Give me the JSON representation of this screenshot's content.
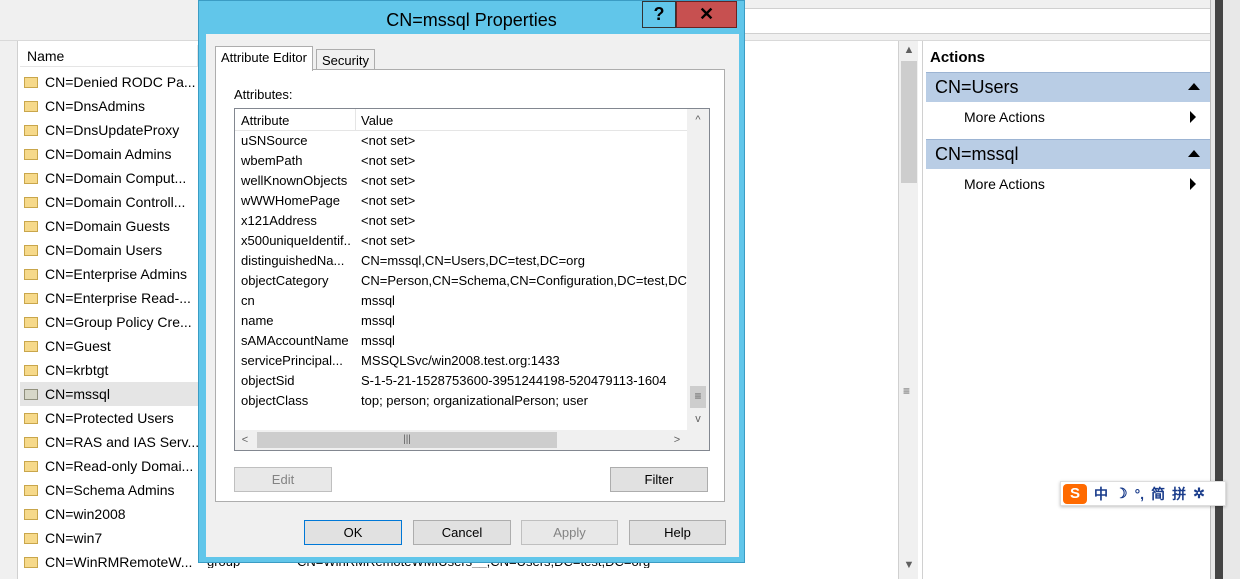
{
  "background": {
    "list_header": "Name",
    "rows": [
      {
        "name": "CN=Denied RODC Pa...",
        "sel": false
      },
      {
        "name": "CN=DnsAdmins",
        "sel": false
      },
      {
        "name": "CN=DnsUpdateProxy",
        "sel": false
      },
      {
        "name": "CN=Domain Admins",
        "sel": false
      },
      {
        "name": "CN=Domain Comput...",
        "sel": false
      },
      {
        "name": "CN=Domain Controll...",
        "sel": false
      },
      {
        "name": "CN=Domain Guests",
        "sel": false
      },
      {
        "name": "CN=Domain Users",
        "sel": false
      },
      {
        "name": "CN=Enterprise Admins",
        "sel": false
      },
      {
        "name": "CN=Enterprise Read-...",
        "sel": false
      },
      {
        "name": "CN=Group Policy Cre...",
        "sel": false
      },
      {
        "name": "CN=Guest",
        "sel": false
      },
      {
        "name": "CN=krbtgt",
        "sel": false
      },
      {
        "name": "CN=mssql",
        "sel": true
      },
      {
        "name": "CN=Protected Users",
        "sel": false
      },
      {
        "name": "CN=RAS and IAS Serv...",
        "sel": false
      },
      {
        "name": "CN=Read-only Domai...",
        "sel": false
      },
      {
        "name": "CN=Schema Admins",
        "sel": false
      },
      {
        "name": "CN=win2008",
        "sel": false
      },
      {
        "name": "CN=win7",
        "sel": false
      },
      {
        "name": "CN=WinRMRemoteW...",
        "sel": false
      }
    ],
    "last_row_type": "group",
    "last_row_dn": "CN=WinRMRemoteWMIUsers__,CN=Users,DC=test,DC=org"
  },
  "actions": {
    "title": "Actions",
    "sections": [
      {
        "title": "CN=Users",
        "item": "More Actions"
      },
      {
        "title": "CN=mssql",
        "item": "More Actions"
      }
    ]
  },
  "ime": {
    "logo": "S",
    "items": [
      "中",
      "☽",
      "°,",
      "简",
      "拼",
      "✲"
    ]
  },
  "dialog": {
    "title": "CN=mssql Properties",
    "help_glyph": "?",
    "close_glyph": "✕",
    "tabs": [
      "Attribute Editor",
      "Security"
    ],
    "attributes_label": "Attributes:",
    "columns": [
      "Attribute",
      "Value"
    ],
    "rows": [
      {
        "k": "uSNSource",
        "v": "<not set>"
      },
      {
        "k": "wbemPath",
        "v": "<not set>"
      },
      {
        "k": "wellKnownObjects",
        "v": "<not set>"
      },
      {
        "k": "wWWHomePage",
        "v": "<not set>"
      },
      {
        "k": "x121Address",
        "v": "<not set>"
      },
      {
        "k": "x500uniqueIdentif...",
        "v": "<not set>"
      },
      {
        "k": "distinguishedNa...",
        "v": "CN=mssql,CN=Users,DC=test,DC=org"
      },
      {
        "k": "objectCategory",
        "v": "CN=Person,CN=Schema,CN=Configuration,DC=test,DC"
      },
      {
        "k": "cn",
        "v": "mssql"
      },
      {
        "k": "name",
        "v": "mssql"
      },
      {
        "k": "sAMAccountName",
        "v": "mssql"
      },
      {
        "k": "servicePrincipal...",
        "v": "MSSQLSvc/win2008.test.org:1433"
      },
      {
        "k": "objectSid",
        "v": "S-1-5-21-1528753600-3951244198-520479113-1604"
      },
      {
        "k": "objectClass",
        "v": "top; person; organizationalPerson; user"
      }
    ],
    "edit_label": "Edit",
    "filter_label": "Filter",
    "ok_label": "OK",
    "cancel_label": "Cancel",
    "apply_label": "Apply",
    "help_label": "Help"
  }
}
